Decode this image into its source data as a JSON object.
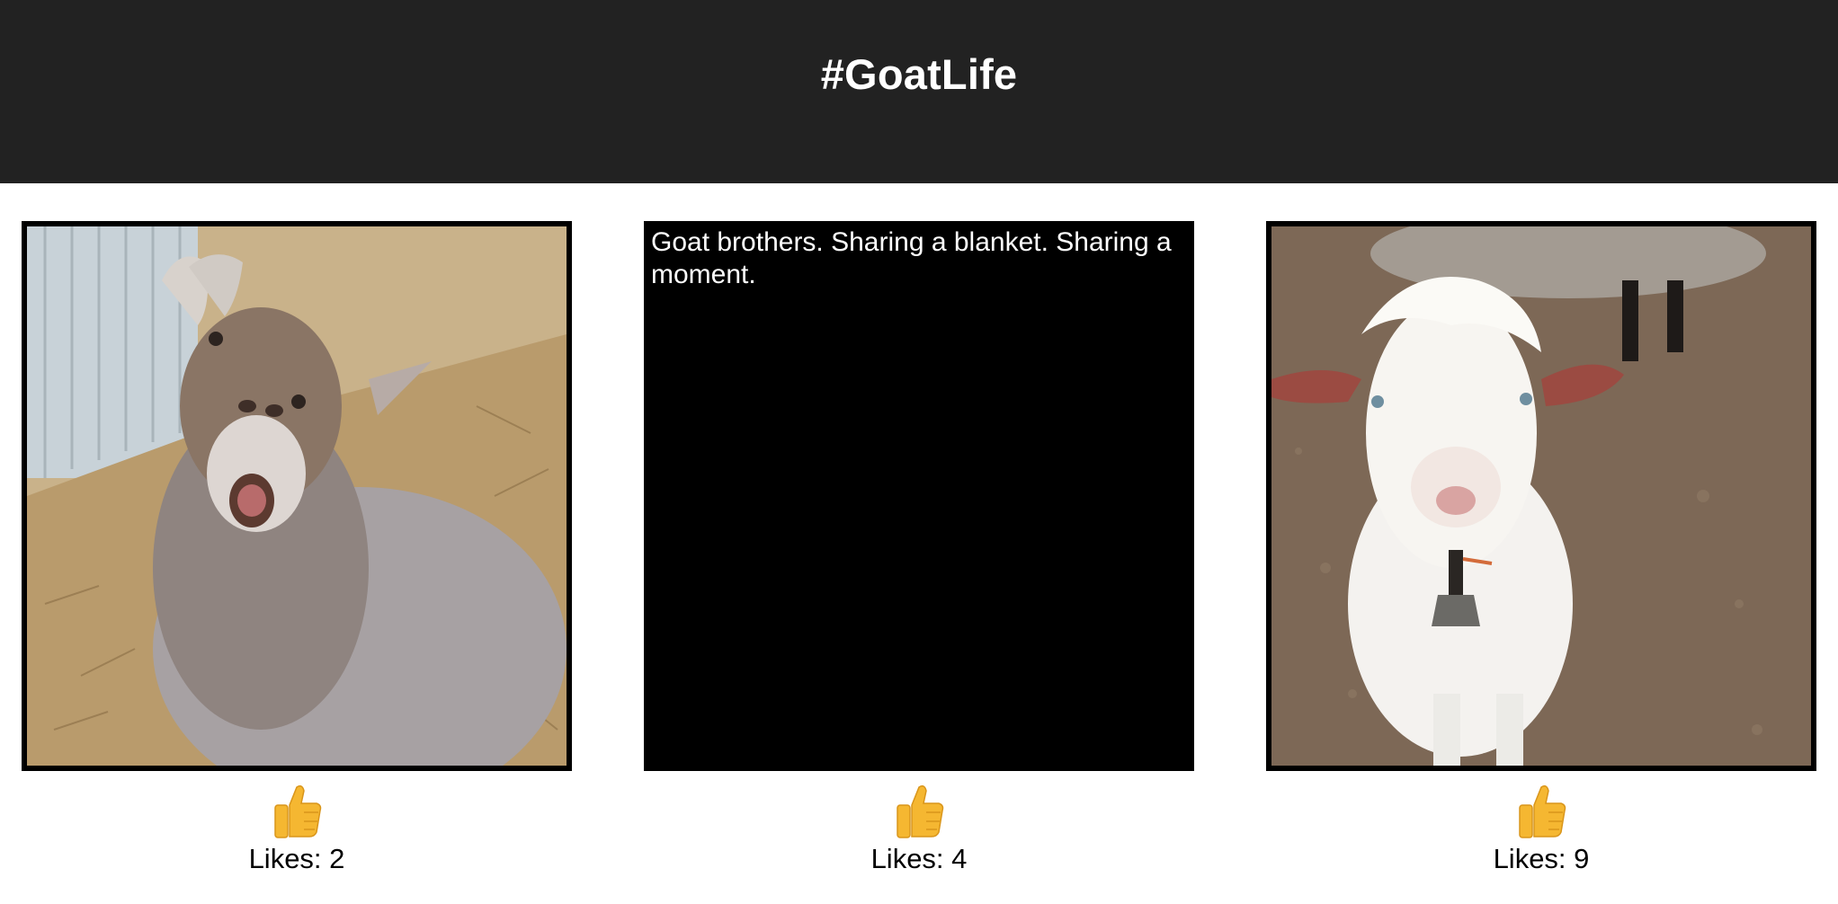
{
  "header": {
    "title": "#GoatLife"
  },
  "posts": [
    {
      "type": "image",
      "image_alt": "brown goat with open mouth lying in straw",
      "likes_label": "Likes:",
      "likes_value": "2"
    },
    {
      "type": "caption",
      "caption": "Goat brothers. Sharing a blanket. Sharing a moment.",
      "likes_label": "Likes:",
      "likes_value": "4"
    },
    {
      "type": "image",
      "image_alt": "white fluffy goat with bell",
      "likes_label": "Likes:",
      "likes_value": "9"
    }
  ],
  "icons": {
    "like": "thumbs-up-icon"
  },
  "colors": {
    "header_bg": "#222222",
    "thumb": "#F5B731"
  }
}
